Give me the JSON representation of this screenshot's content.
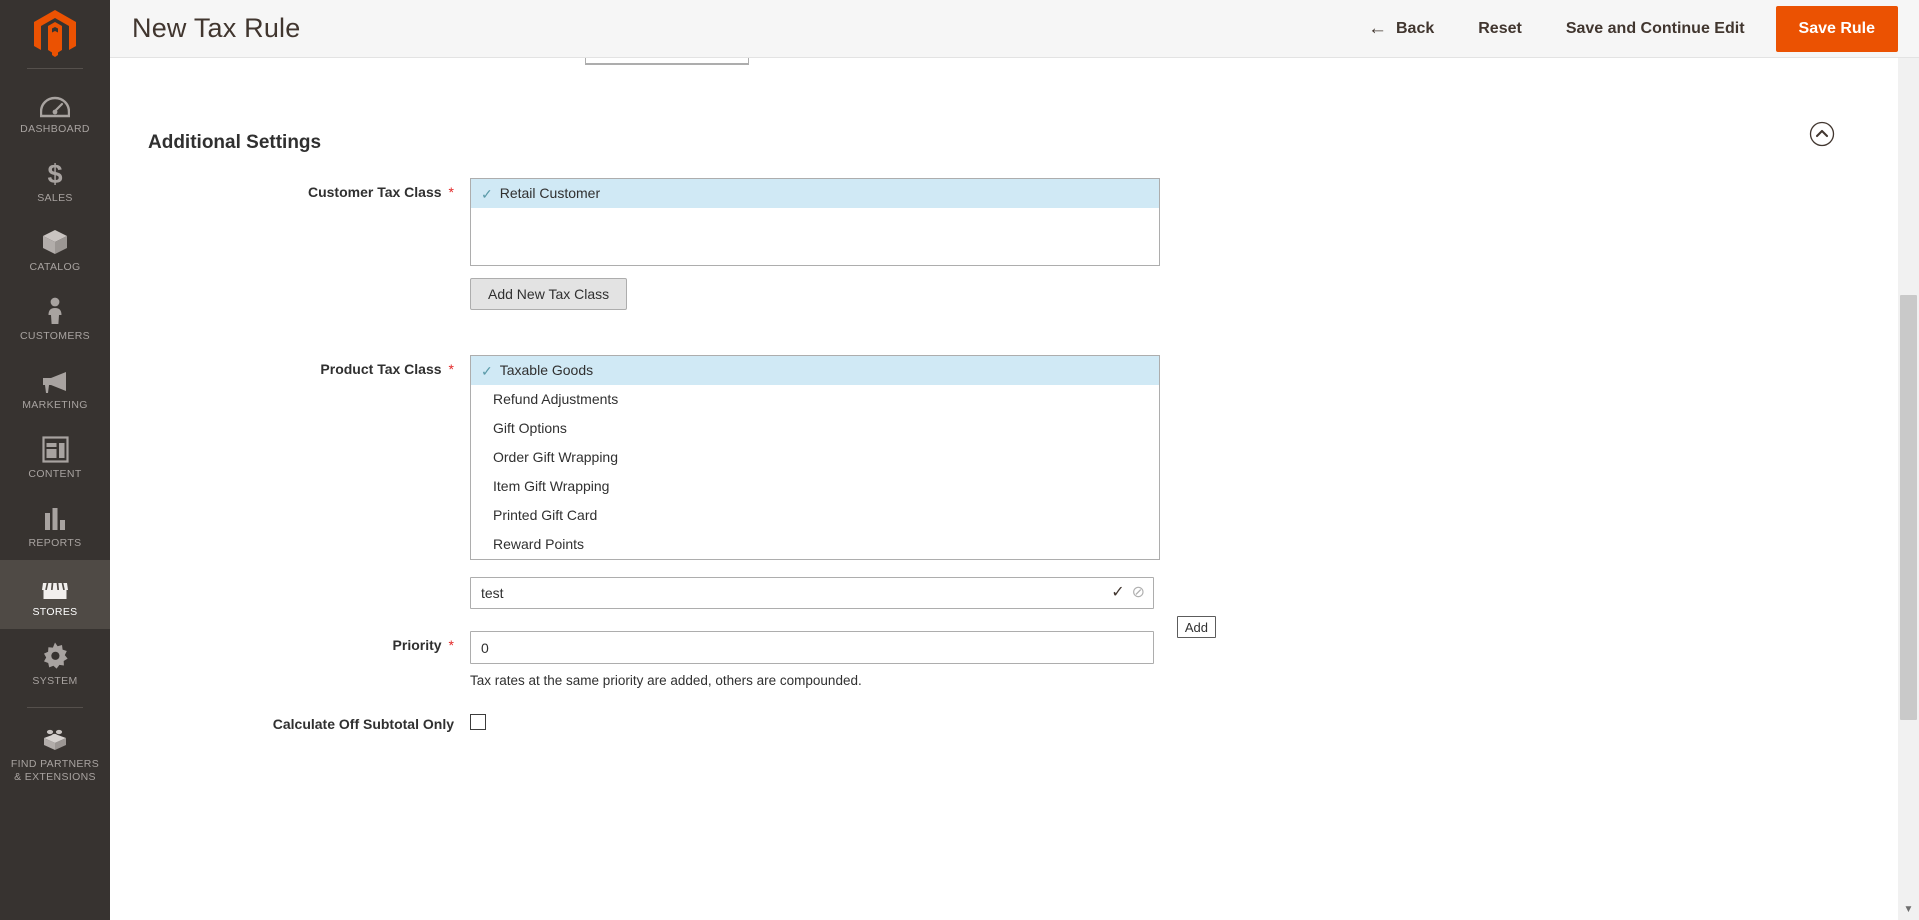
{
  "sidebar": {
    "logo_name": "magento-logo",
    "items": [
      {
        "label": "Dashboard",
        "icon": "dashboard-icon",
        "active": false
      },
      {
        "label": "Sales",
        "icon": "dollar-icon",
        "active": false
      },
      {
        "label": "Catalog",
        "icon": "box-icon",
        "active": false
      },
      {
        "label": "Customers",
        "icon": "person-icon",
        "active": false
      },
      {
        "label": "Marketing",
        "icon": "megaphone-icon",
        "active": false
      },
      {
        "label": "Content",
        "icon": "layout-icon",
        "active": false
      },
      {
        "label": "Reports",
        "icon": "bar-chart-icon",
        "active": false
      },
      {
        "label": "Stores",
        "icon": "store-icon",
        "active": true
      },
      {
        "label": "System",
        "icon": "gear-icon",
        "active": false
      }
    ],
    "footer_item": {
      "label_line1": "Find Partners",
      "label_line2": "& Extensions",
      "icon": "lego-brick-icon"
    }
  },
  "header": {
    "title": "New Tax Rule",
    "back_label": "Back",
    "back_icon": "arrow-left-icon",
    "reset_label": "Reset",
    "save_continue_label": "Save and Continue Edit",
    "save_label": "Save Rule",
    "primary_color": "#eb5202"
  },
  "section": {
    "title": "Additional Settings",
    "collapse_icon": "chevron-up-circle-icon"
  },
  "customer_tax_class": {
    "label": "Customer Tax Class",
    "required_marker": "*",
    "options": [
      {
        "label": "Retail Customer",
        "selected": true
      }
    ],
    "add_button_label": "Add New Tax Class"
  },
  "product_tax_class": {
    "label": "Product Tax Class",
    "required_marker": "*",
    "options": [
      {
        "label": "Taxable Goods",
        "selected": true
      },
      {
        "label": "Refund Adjustments",
        "selected": false
      },
      {
        "label": "Gift Options",
        "selected": false
      },
      {
        "label": "Order Gift Wrapping",
        "selected": false
      },
      {
        "label": "Item Gift Wrapping",
        "selected": false
      },
      {
        "label": "Printed Gift Card",
        "selected": false
      },
      {
        "label": "Reward Points",
        "selected": false
      }
    ],
    "new_class_value": "test",
    "new_class_placeholder": "",
    "confirm_icon": "check-icon",
    "cancel_icon": "no-entry-icon",
    "add_button_label": "Add"
  },
  "priority": {
    "label": "Priority",
    "required_marker": "*",
    "value": "0",
    "note": "Tax rates at the same priority are added, others are compounded."
  },
  "calculate_off_subtotal": {
    "label": "Calculate Off Subtotal Only",
    "checked": false
  },
  "selected_highlight_color": "#d0e9f5",
  "check_color": "#5a9aa8"
}
